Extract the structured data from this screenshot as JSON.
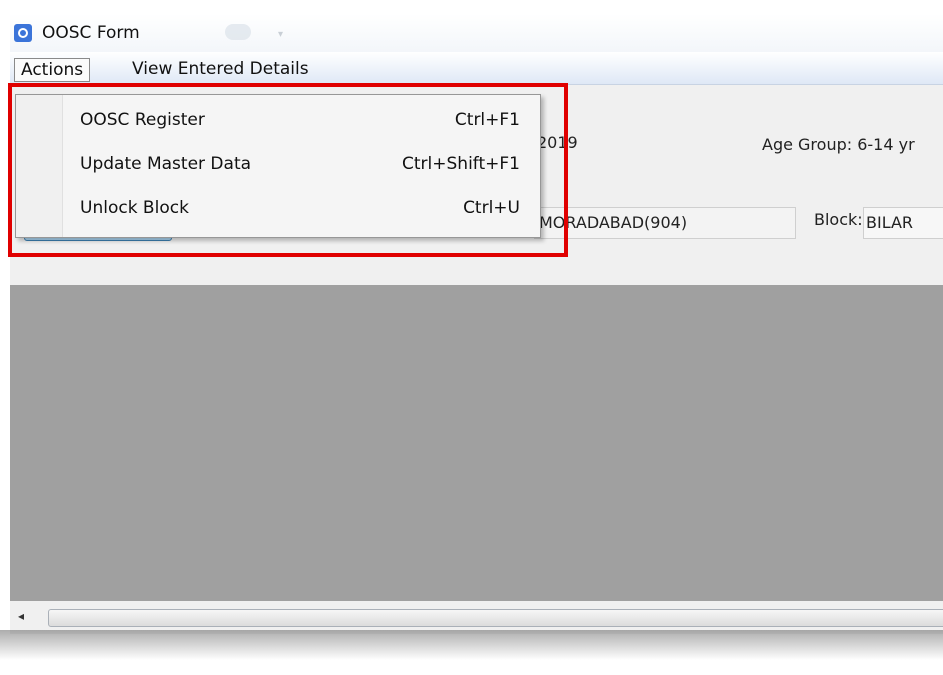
{
  "window": {
    "title": "OOSC Form"
  },
  "menubar": {
    "actions": "Actions",
    "view_entered_details": "View Entered Details"
  },
  "header": {
    "year_fragment": "2019",
    "age_group": "Age Group: 6-14 yr",
    "district_value": "MORADABAD(904)",
    "block_label": "Block:",
    "block_value": "BILAR"
  },
  "actions_menu": {
    "items": [
      {
        "label": "OOSC Register",
        "shortcut": "Ctrl+F1"
      },
      {
        "label": "Update Master Data",
        "shortcut": "Ctrl+Shift+F1"
      },
      {
        "label": "Unlock Block",
        "shortcut": "Ctrl+U"
      }
    ]
  },
  "scrollbar": {
    "left_arrow": "◂"
  },
  "colors": {
    "highlight": "#e00000",
    "panel_grey": "#a0a0a0",
    "menu_bg": "#f5f5f5"
  }
}
